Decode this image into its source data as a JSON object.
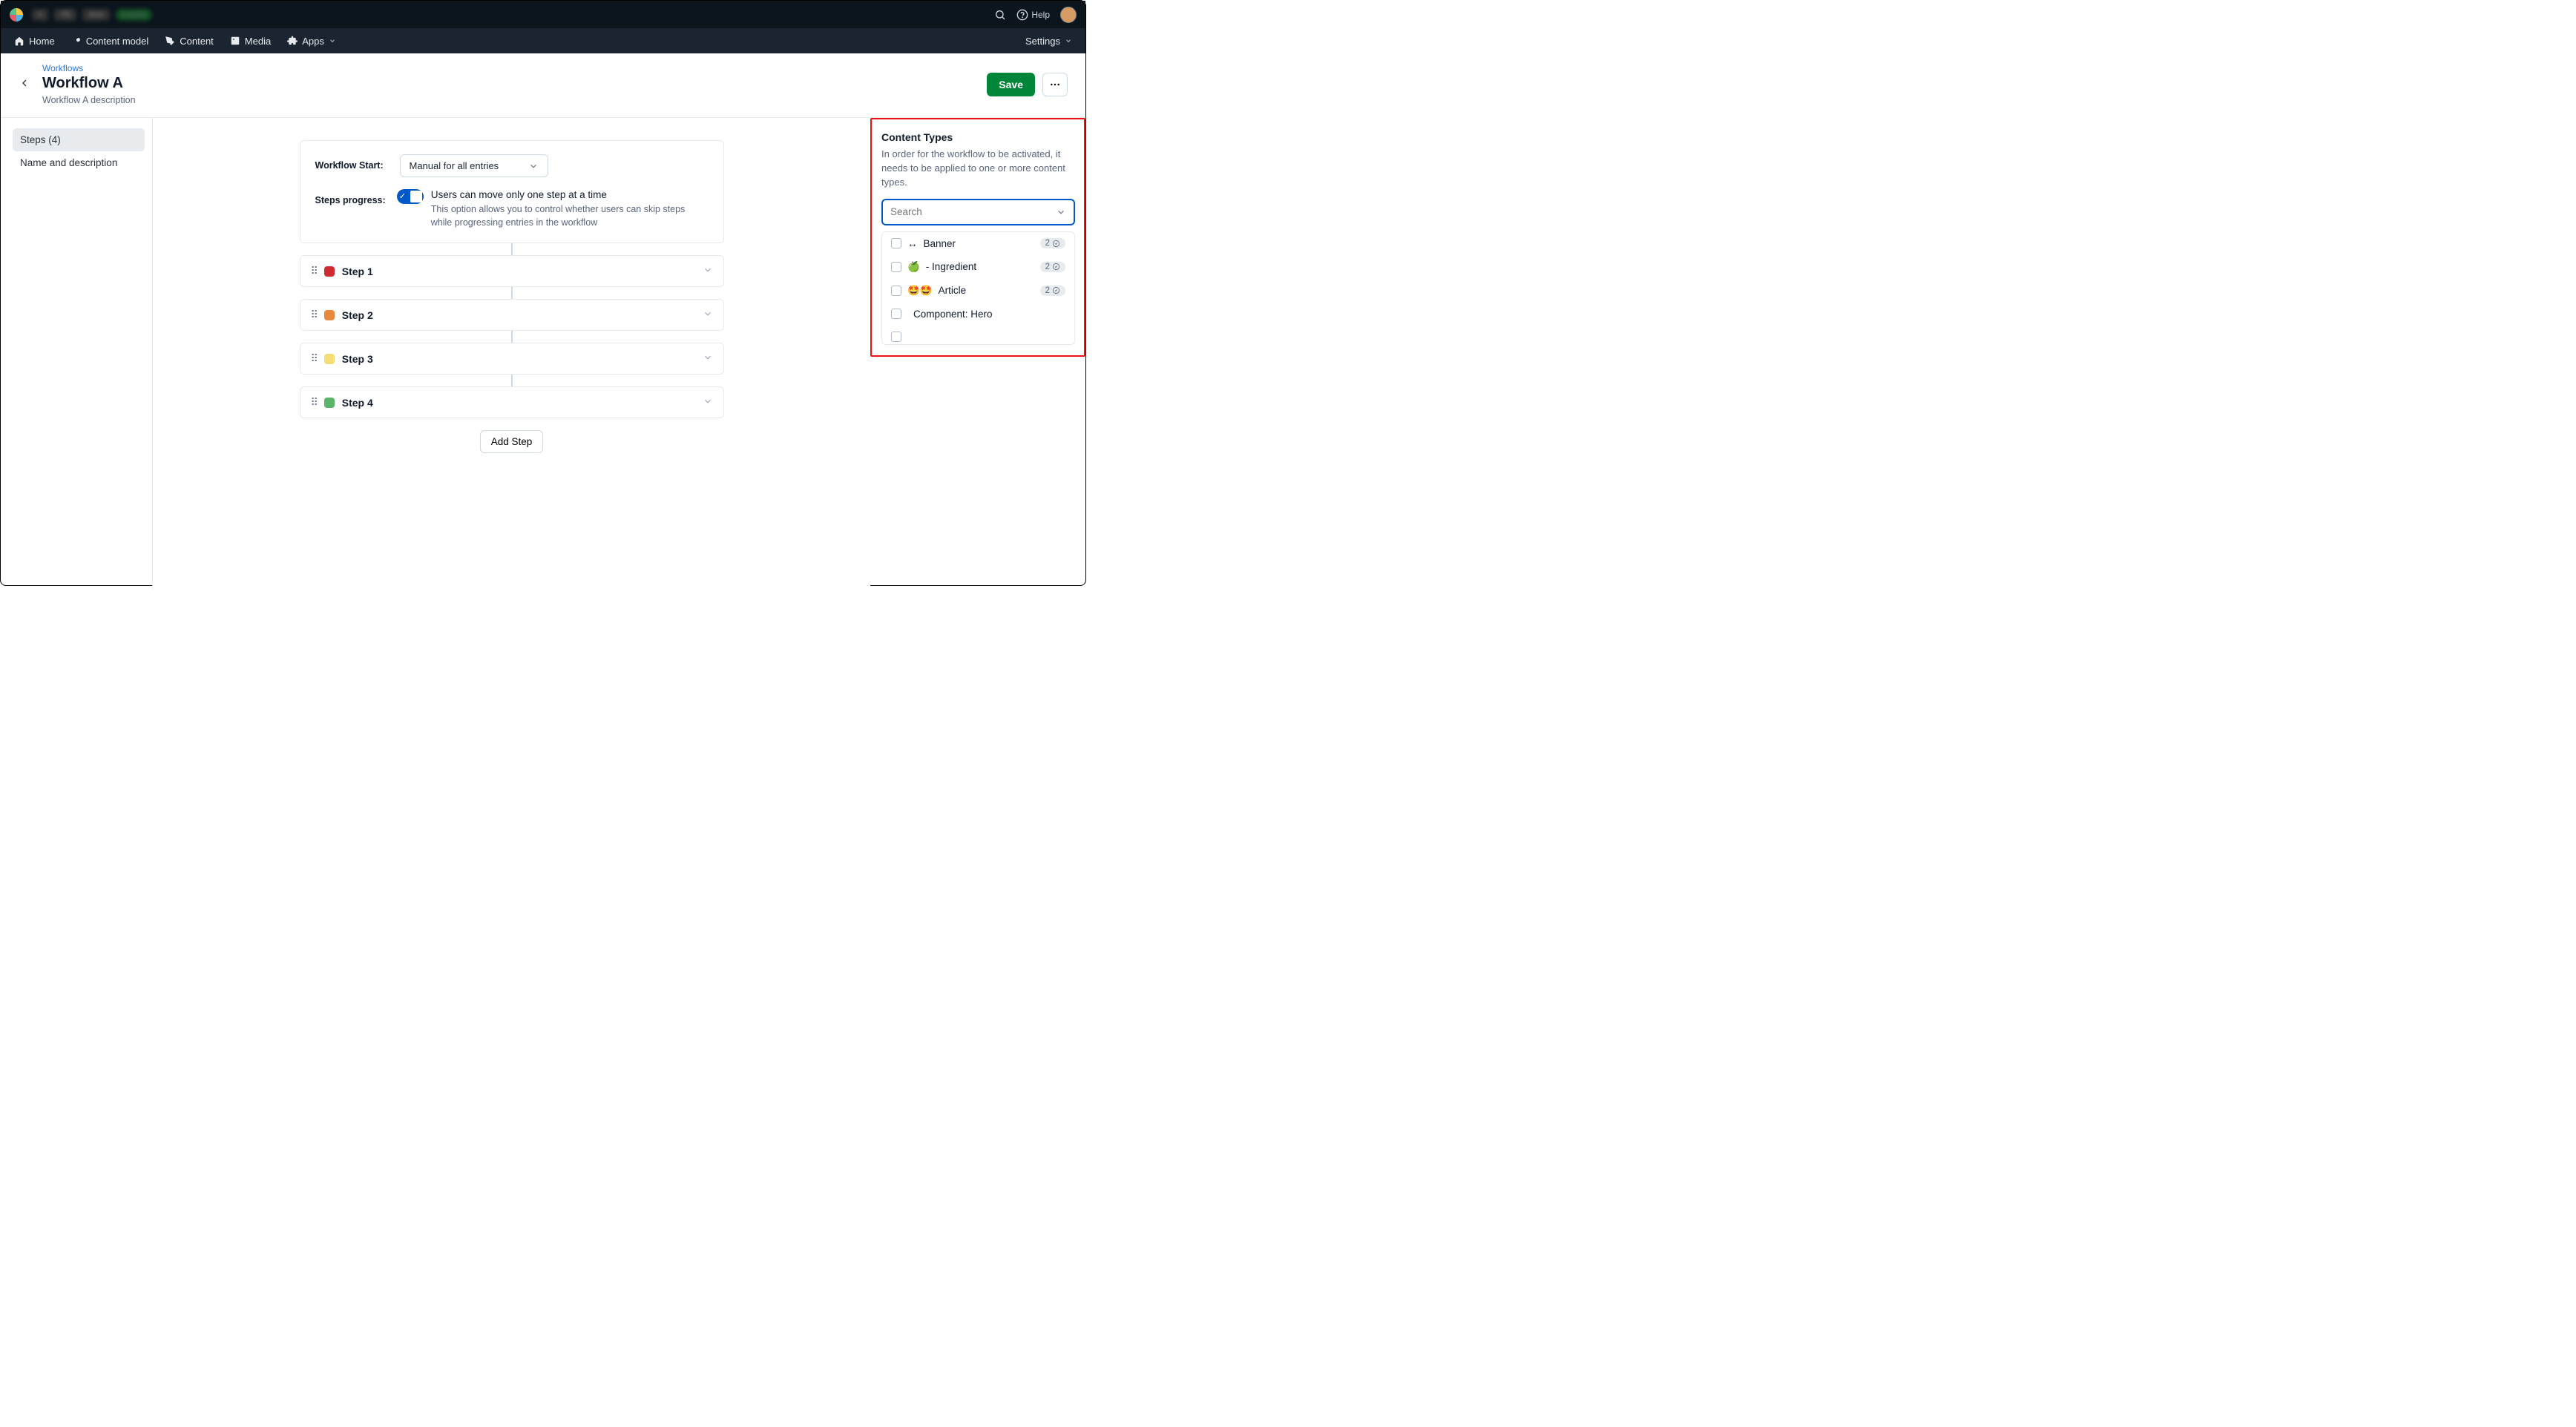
{
  "topbar": {
    "help_label": "Help"
  },
  "nav": {
    "home": "Home",
    "content_model": "Content model",
    "content": "Content",
    "media": "Media",
    "apps": "Apps",
    "settings": "Settings"
  },
  "header": {
    "breadcrumb": "Workflows",
    "title": "Workflow A",
    "description": "Workflow A description",
    "save": "Save"
  },
  "left_sidebar": {
    "steps_label": "Steps (4)",
    "name_desc_label": "Name and description"
  },
  "config": {
    "workflow_start_label": "Workflow Start:",
    "workflow_start_value": "Manual for all entries",
    "steps_progress_label": "Steps progress:",
    "toggle_title": "Users can move only one step at a time",
    "toggle_desc": "This option allows you to control whether users can skip steps while progressing entries in the workflow"
  },
  "steps": [
    {
      "label": "Step 1",
      "color": "#cf2a32"
    },
    {
      "label": "Step 2",
      "color": "#e9873b"
    },
    {
      "label": "Step 3",
      "color": "#f5de76"
    },
    {
      "label": "Step 4",
      "color": "#59b368"
    }
  ],
  "add_step_label": "Add Step",
  "right_panel": {
    "title": "Content Types",
    "description": "In order for the workflow to be activated, it needs to be applied to one or more content types.",
    "search_placeholder": "Search",
    "items": [
      {
        "icon": "↔",
        "label": "Banner",
        "count": "2"
      },
      {
        "icon": "🍏",
        "label": "- Ingredient",
        "count": "2"
      },
      {
        "icon": "🤩🤩",
        "label": "Article",
        "count": "2"
      },
      {
        "icon": "",
        "label": "Component: Hero",
        "count": ""
      },
      {
        "icon": "",
        "label": "",
        "count": ""
      }
    ]
  }
}
